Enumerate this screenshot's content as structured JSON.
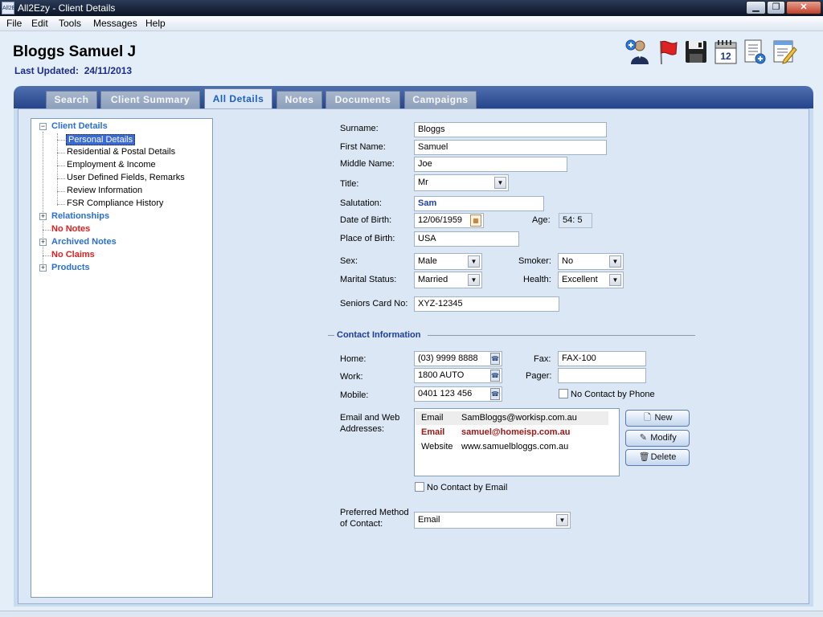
{
  "window": {
    "title": "All2Ezy - Client Details",
    "app_icon_text": "All2Ezy"
  },
  "menu": [
    "File",
    "Edit",
    "Tools",
    "Messages",
    "Help"
  ],
  "header": {
    "client_name": "Bloggs Samuel J",
    "last_updated_label": "Last Updated:",
    "last_updated_value": "24/11/2013"
  },
  "toolbar_icons": [
    "add-person-icon",
    "flag-icon",
    "save-icon",
    "calendar-icon",
    "add-document-icon",
    "edit-notes-icon"
  ],
  "calendar_icon_text": "12",
  "tabs": [
    "Search",
    "Client Summary",
    "All Details",
    "Notes",
    "Documents",
    "Campaigns"
  ],
  "active_tab": "All Details",
  "tree": {
    "client_details": "Client Details",
    "children": [
      "Personal Details",
      "Residential & Postal Details",
      "Employment & Income",
      "User Defined Fields, Remarks",
      "Review Information",
      "FSR Compliance History"
    ],
    "relationships": "Relationships",
    "no_notes": "No Notes",
    "archived_notes": "Archived Notes",
    "no_claims": "No Claims",
    "products": "Products"
  },
  "form": {
    "surname_label": "Surname:",
    "surname": "Bloggs",
    "first_name_label": "First Name:",
    "first_name": "Samuel",
    "middle_name_label": "Middle Name:",
    "middle_name": "Joe",
    "title_label": "Title:",
    "title": "Mr",
    "salutation_label": "Salutation:",
    "salutation": "Sam",
    "dob_label": "Date of Birth:",
    "dob": "12/06/1959",
    "age_label": "Age:",
    "age": "54: 5",
    "pob_label": "Place of Birth:",
    "pob": "USA",
    "sex_label": "Sex:",
    "sex": "Male",
    "smoker_label": "Smoker:",
    "smoker": "No",
    "marital_label": "Marital Status:",
    "marital": "Married",
    "health_label": "Health:",
    "health": "Excellent",
    "seniors_label": "Seniors Card No:",
    "seniors": "XYZ-12345"
  },
  "contact": {
    "section_title": "Contact Information",
    "home_label": "Home:",
    "home": "(03) 9999 8888",
    "work_label": "Work:",
    "work": "1800 AUTO",
    "mobile_label": "Mobile:",
    "mobile": "0401 123 456",
    "fax_label": "Fax:",
    "fax": "FAX-100",
    "pager_label": "Pager:",
    "pager": "",
    "no_contact_phone": "No Contact by Phone",
    "email_label_1": "Email and Web",
    "email_label_2": "Addresses:",
    "emails": [
      {
        "type": "Email",
        "address": "SamBloggs@workisp.com.au"
      },
      {
        "type": "Email",
        "address": "samuel@homeisp.com.au"
      },
      {
        "type": "Website",
        "address": "www.samuelbloggs.com.au"
      }
    ],
    "new_button": "New",
    "modify_button": "Modify",
    "delete_button": "Delete",
    "no_contact_email": "No Contact by Email",
    "pref_label_1": "Preferred Method",
    "pref_label_2": "of Contact:",
    "pref": "Email"
  }
}
